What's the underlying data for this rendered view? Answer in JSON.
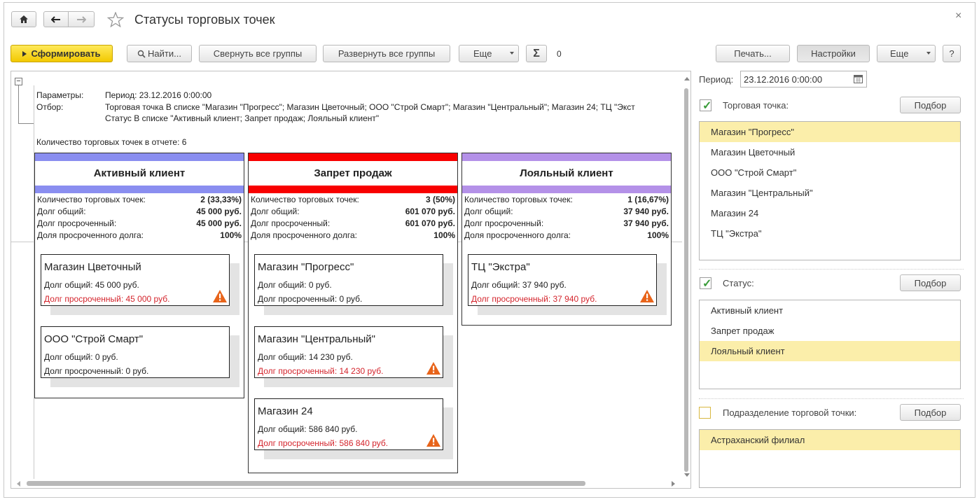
{
  "title": "Статусы торговых точек",
  "toolbar": {
    "generate": "Сформировать",
    "find": "Найти...",
    "collapse": "Свернуть все группы",
    "expand": "Развернуть все группы",
    "more": "Еще",
    "sigma": "Σ",
    "sum": "0",
    "print": "Печать...",
    "settings": "Настройки",
    "more2": "Еще",
    "help": "?"
  },
  "report": {
    "params_label": "Параметры:",
    "params_value": "Период: 23.12.2016 0:00:00",
    "filter_label": "Отбор:",
    "filter_line1": "Торговая точка В списке \"Магазин \"Прогресс\"; Магазин Цветочный; ООО \"Строй Смарт\"; Магазин \"Центральный\"; Магазин 24; ТЦ \"Экст",
    "filter_line2": "Статус В списке \"Активный клиент; Запрет продаж; Лояльный клиент\"",
    "count_line": "Количество торговых точек в отчете: 6",
    "stat_labels": [
      "Количество торговых точек:",
      "Долг общий:",
      "Долг просроченный:",
      "Доля просроченного долга:"
    ],
    "columns": [
      {
        "title": "Активный клиент",
        "color": "#8a8ef0",
        "values": [
          "2 (33,33%)",
          "45 000 руб.",
          "45 000 руб.",
          "100%"
        ],
        "cards": [
          {
            "name": "Магазин Цветочный",
            "total": "Долг общий: 45 000 руб.",
            "overdue": "Долг просроченный: 45 000 руб.",
            "warn": true
          },
          {
            "name": "ООО \"Строй Смарт\"",
            "total": "Долг общий: 0 руб.",
            "overdue": "Долг просроченный: 0 руб.",
            "warn": false
          }
        ]
      },
      {
        "title": "Запрет продаж",
        "color": "#f80000",
        "values": [
          "3 (50%)",
          "601 070 руб.",
          "601 070 руб.",
          "100%"
        ],
        "cards": [
          {
            "name": "Магазин \"Прогресс\"",
            "total": "Долг общий: 0 руб.",
            "overdue": "Долг просроченный: 0 руб.",
            "warn": false
          },
          {
            "name": "Магазин \"Центральный\"",
            "total": "Долг общий: 14 230 руб.",
            "overdue": "Долг просроченный: 14 230 руб.",
            "warn": true
          },
          {
            "name": "Магазин 24",
            "total": "Долг общий: 586 840 руб.",
            "overdue": "Долг просроченный: 586 840 руб.",
            "warn": true
          }
        ]
      },
      {
        "title": "Лояльный клиент",
        "color": "#b491e8",
        "values": [
          "1 (16,67%)",
          "37 940 руб.",
          "37 940 руб.",
          "100%"
        ],
        "cards": [
          {
            "name": "ТЦ \"Экстра\"",
            "total": "Долг общий: 37 940 руб.",
            "overdue": "Долг просроченный: 37 940 руб.",
            "warn": true
          }
        ]
      }
    ]
  },
  "settings": {
    "period_label": "Период:",
    "period_value": "23.12.2016  0:00:00",
    "outlet_label": "Торговая точка:",
    "pick": "Подбор",
    "outlets": [
      "Магазин \"Прогресс\"",
      "Магазин Цветочный",
      "ООО \"Строй Смарт\"",
      "Магазин \"Центральный\"",
      "Магазин 24",
      "ТЦ \"Экстра\""
    ],
    "status_label": "Статус:",
    "statuses": [
      "Активный клиент",
      "Запрет продаж",
      "Лояльный клиент"
    ],
    "division_label": "Подразделение торговой точки:",
    "divisions": [
      "Астраханский филиал"
    ]
  }
}
